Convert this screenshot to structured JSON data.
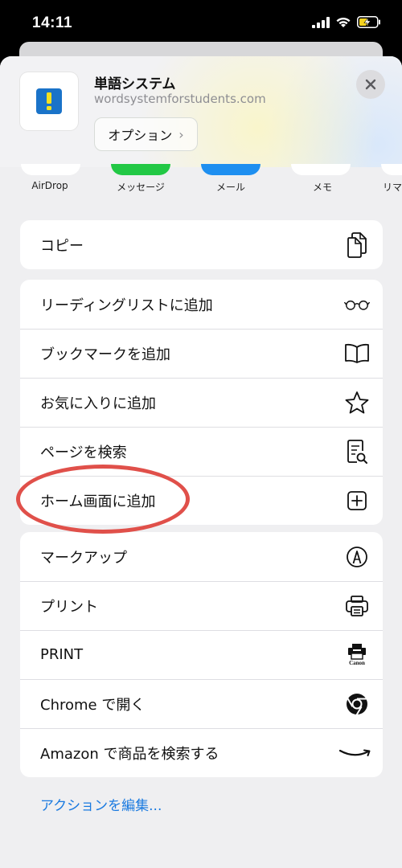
{
  "status_bar": {
    "time": "14:11"
  },
  "header": {
    "app_title": "単語システム",
    "app_url": "wordsystemforstudents.com",
    "options_label": "オプション",
    "options_chevron": "›"
  },
  "share_targets": [
    {
      "label": "AirDrop",
      "color": "#ffffff"
    },
    {
      "label": "メッセージ",
      "color": "#22c845"
    },
    {
      "label": "メール",
      "color": "#1e8ff0"
    },
    {
      "label": "メモ",
      "color": "#ffffff"
    },
    {
      "label": "リマ",
      "color": "#ffffff"
    }
  ],
  "groups": {
    "copy": [
      {
        "label": "コピー",
        "icon": "copy-icon"
      }
    ],
    "page": [
      {
        "label": "リーディングリストに追加",
        "icon": "glasses-icon"
      },
      {
        "label": "ブックマークを追加",
        "icon": "book-icon"
      },
      {
        "label": "お気に入りに追加",
        "icon": "star-icon"
      },
      {
        "label": "ページを検索",
        "icon": "find-in-page-icon"
      },
      {
        "label": "ホーム画面に追加",
        "icon": "add-square-icon"
      }
    ],
    "actions": [
      {
        "label": "マークアップ",
        "icon": "markup-pen-icon"
      },
      {
        "label": "プリント",
        "icon": "printer-icon"
      },
      {
        "label": "PRINT",
        "icon": "canon-print-icon",
        "brand_text": "Canon"
      },
      {
        "label": "Chrome で開く",
        "icon": "chrome-icon"
      },
      {
        "label": "Amazon で商品を検索する",
        "icon": "amazon-smile-icon"
      }
    ]
  },
  "edit_actions_label": "アクションを編集...",
  "colors": {
    "accent_link": "#1a7ae0",
    "highlight_ring": "#e0504a",
    "app_icon_blue": "#1a73c9",
    "app_icon_yellow": "#f5e020"
  }
}
